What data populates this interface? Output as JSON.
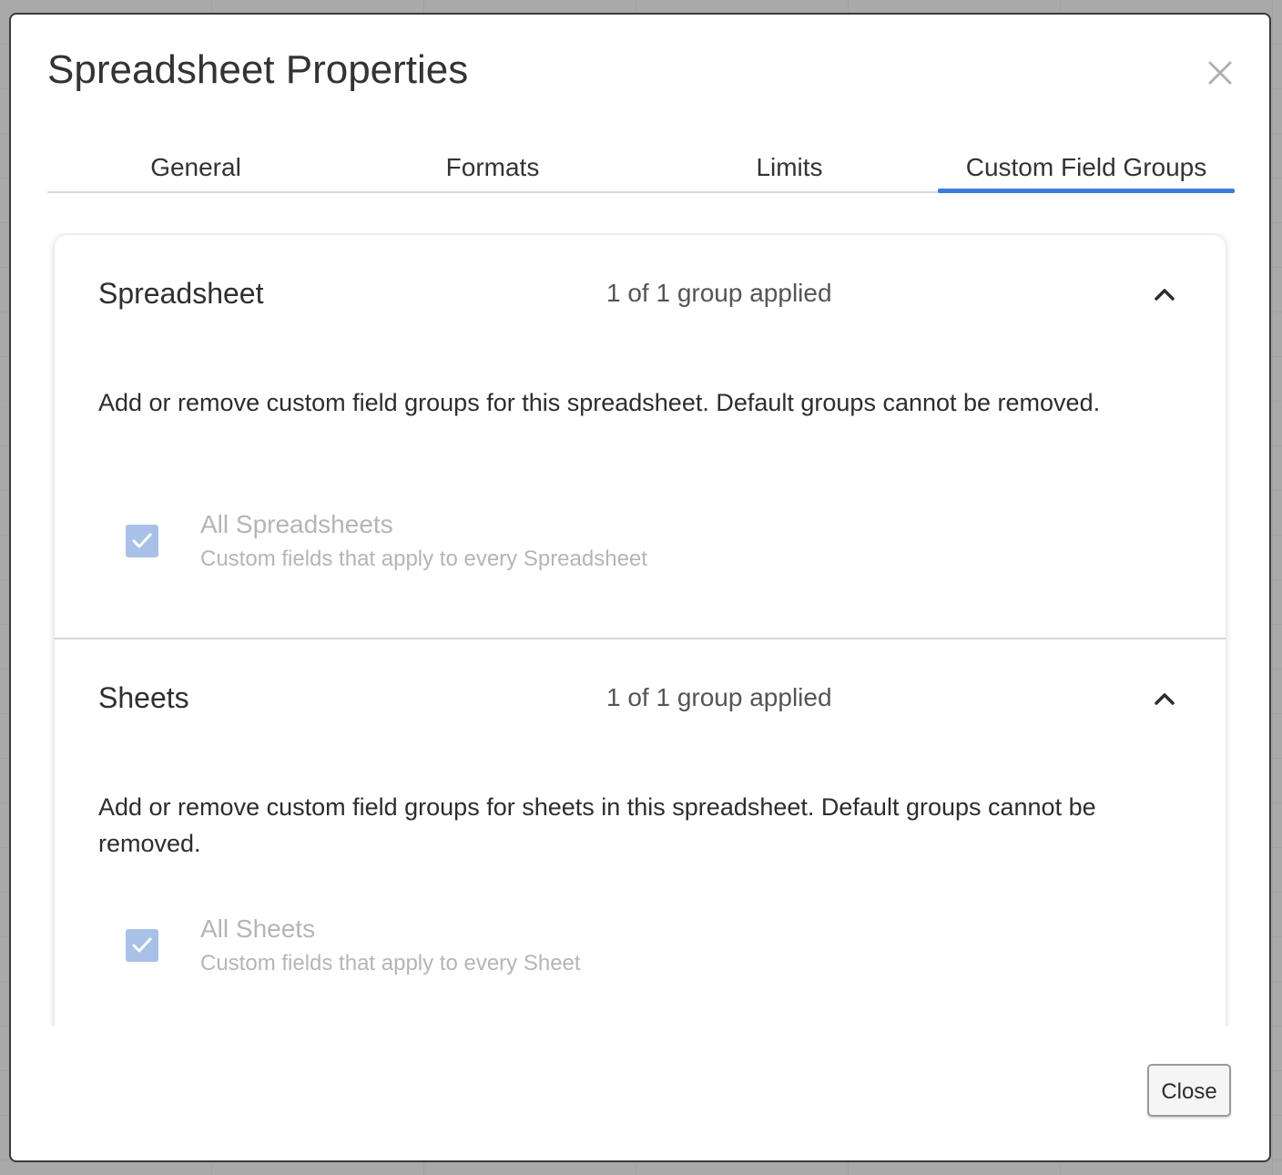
{
  "dialog": {
    "title": "Spreadsheet Properties",
    "close_icon": "close-icon",
    "tabs": [
      {
        "label": "General"
      },
      {
        "label": "Formats"
      },
      {
        "label": "Limits"
      },
      {
        "label": "Custom Field Groups",
        "active": true
      }
    ],
    "sections": [
      {
        "title": "Spreadsheet",
        "count": "1 of 1 group applied",
        "expanded": true,
        "description": "Add or remove custom field groups for this spreadsheet. Default groups cannot be removed.",
        "options": [
          {
            "title": "All Spreadsheets",
            "subtitle": "Custom fields that apply to every Spreadsheet",
            "checked": true,
            "disabled": true
          }
        ]
      },
      {
        "title": "Sheets",
        "count": "1 of 1 group applied",
        "expanded": true,
        "description": "Add or remove custom field groups for sheets in this spreadsheet. Default groups cannot be removed.",
        "options": [
          {
            "title": "All Sheets",
            "subtitle": "Custom fields that apply to every Sheet",
            "checked": true,
            "disabled": true
          }
        ]
      }
    ],
    "footer": {
      "close_label": "Close"
    }
  },
  "colors": {
    "accent": "#3b7bdc",
    "checkbox_disabled": "#a9c0e8",
    "muted_text": "#b5b5b5"
  }
}
